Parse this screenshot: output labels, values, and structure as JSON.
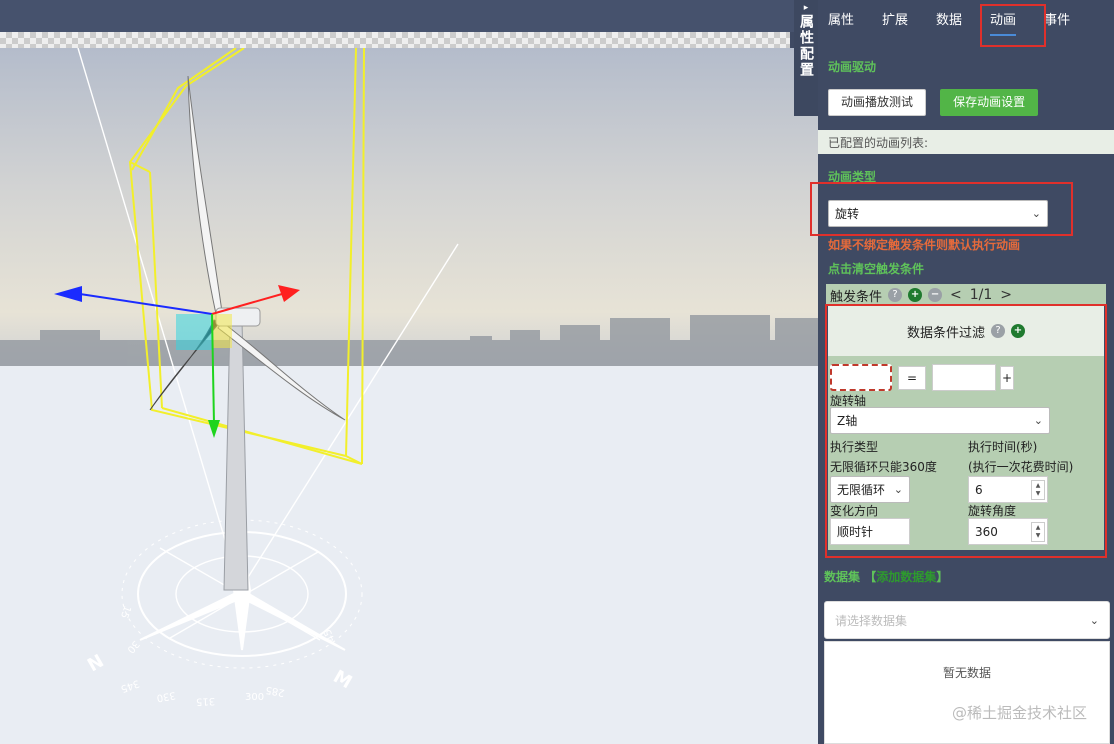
{
  "side_toggle": {
    "arrow": "▸",
    "label": "属性配置"
  },
  "tabs": [
    {
      "label": "属性"
    },
    {
      "label": "扩展"
    },
    {
      "label": "数据"
    },
    {
      "label": "动画"
    },
    {
      "label": "事件"
    }
  ],
  "active_tab": "动画",
  "anim_drive": {
    "title": "动画驱动",
    "test_button": "动画播放测试",
    "save_button": "保存动画设置"
  },
  "configured_list_label": "已配置的动画列表:",
  "anim_type": {
    "label": "动画类型",
    "selected": "旋转"
  },
  "warning_text": "如果不绑定触发条件则默认执行动画",
  "clear_trigger_link": "点击清空触发条件",
  "trigger": {
    "label": "触发条件",
    "pager_text": "1/1",
    "prev": "<",
    "next": ">"
  },
  "filter": {
    "title": "数据条件过滤",
    "operator": "=",
    "add": "+"
  },
  "rotation_axis": {
    "label": "旋转轴",
    "selected": "Z轴"
  },
  "exec_type": {
    "label": "执行类型",
    "note": "无限循环只能360度",
    "selected": "无限循环"
  },
  "exec_time": {
    "label": "执行时间(秒)",
    "note": "(执行一次花费时间)",
    "value": "6"
  },
  "direction": {
    "label": "变化方向",
    "value": "顺时针"
  },
  "rotate_angle": {
    "label": "旋转角度",
    "value": "360"
  },
  "dataset": {
    "label": "数据集",
    "bracket_open": "【",
    "inner": "添加数据集",
    "bracket_close": "】",
    "placeholder": "请选择数据集",
    "empty_text": "暂无数据"
  },
  "watermark": "@稀土掘金技术社区",
  "compass": {
    "letters": [
      "N",
      "M"
    ],
    "ticks": [
      "345",
      "330",
      "315",
      "300",
      "285",
      "15",
      "30",
      "45"
    ]
  },
  "colors": {
    "panel_bg": "#3f4a63",
    "accent_green": "#5fc25a",
    "warn_orange": "#e56a3b",
    "highlight_red": "#e0302b",
    "filter_bg": "#b6ceb2"
  },
  "icons": [
    "help-icon",
    "plus-circle-icon",
    "minus-circle-icon",
    "chevron-down-icon",
    "spinner-arrows-icon"
  ]
}
